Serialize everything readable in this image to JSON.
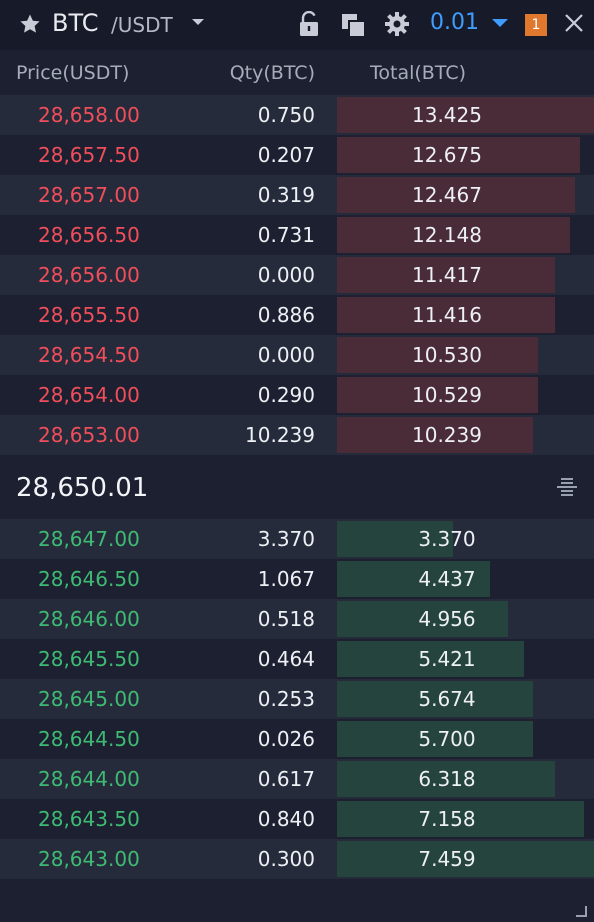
{
  "header": {
    "star_icon": "star-icon",
    "base": "BTC",
    "quote": "/USDT",
    "precision": "0.01",
    "badge": "1",
    "icons": [
      "star-icon",
      "chevron-down-icon",
      "lock-icon",
      "copy-icon",
      "gear-icon",
      "close-icon"
    ]
  },
  "columns": {
    "price": "Price(USDT)",
    "qty": "Qty(BTC)",
    "total": "Total(BTC)"
  },
  "asks": [
    {
      "price": "28,658.00",
      "qty": "0.750",
      "total": "13.425",
      "depth": 1.0
    },
    {
      "price": "28,657.50",
      "qty": "0.207",
      "total": "12.675",
      "depth": 0.944
    },
    {
      "price": "28,657.00",
      "qty": "0.319",
      "total": "12.467",
      "depth": 0.928
    },
    {
      "price": "28,656.50",
      "qty": "0.731",
      "total": "12.148",
      "depth": 0.905
    },
    {
      "price": "28,656.00",
      "qty": "0.000",
      "total": "11.417",
      "depth": 0.85
    },
    {
      "price": "28,655.50",
      "qty": "0.886",
      "total": "11.416",
      "depth": 0.85
    },
    {
      "price": "28,654.50",
      "qty": "0.000",
      "total": "10.530",
      "depth": 0.784
    },
    {
      "price": "28,654.00",
      "qty": "0.290",
      "total": "10.529",
      "depth": 0.784
    },
    {
      "price": "28,653.00",
      "qty": "10.239",
      "total": "10.239",
      "depth": 0.763
    }
  ],
  "mid_price": "28,650.01",
  "bids": [
    {
      "price": "28,647.00",
      "qty": "3.370",
      "total": "3.370",
      "depth": 0.452
    },
    {
      "price": "28,646.50",
      "qty": "1.067",
      "total": "4.437",
      "depth": 0.595
    },
    {
      "price": "28,646.00",
      "qty": "0.518",
      "total": "4.956",
      "depth": 0.664
    },
    {
      "price": "28,645.50",
      "qty": "0.464",
      "total": "5.421",
      "depth": 0.727
    },
    {
      "price": "28,645.00",
      "qty": "0.253",
      "total": "5.674",
      "depth": 0.761
    },
    {
      "price": "28,644.50",
      "qty": "0.026",
      "total": "5.700",
      "depth": 0.764
    },
    {
      "price": "28,644.00",
      "qty": "0.617",
      "total": "6.318",
      "depth": 0.847
    },
    {
      "price": "28,643.50",
      "qty": "0.840",
      "total": "7.158",
      "depth": 0.96
    },
    {
      "price": "28,643.00",
      "qty": "0.300",
      "total": "7.459",
      "depth": 1.0
    }
  ],
  "colors": {
    "ask": "#f04e5a",
    "bid": "#3fba73",
    "accent": "#3f9dff",
    "badge": "#e0782e"
  }
}
